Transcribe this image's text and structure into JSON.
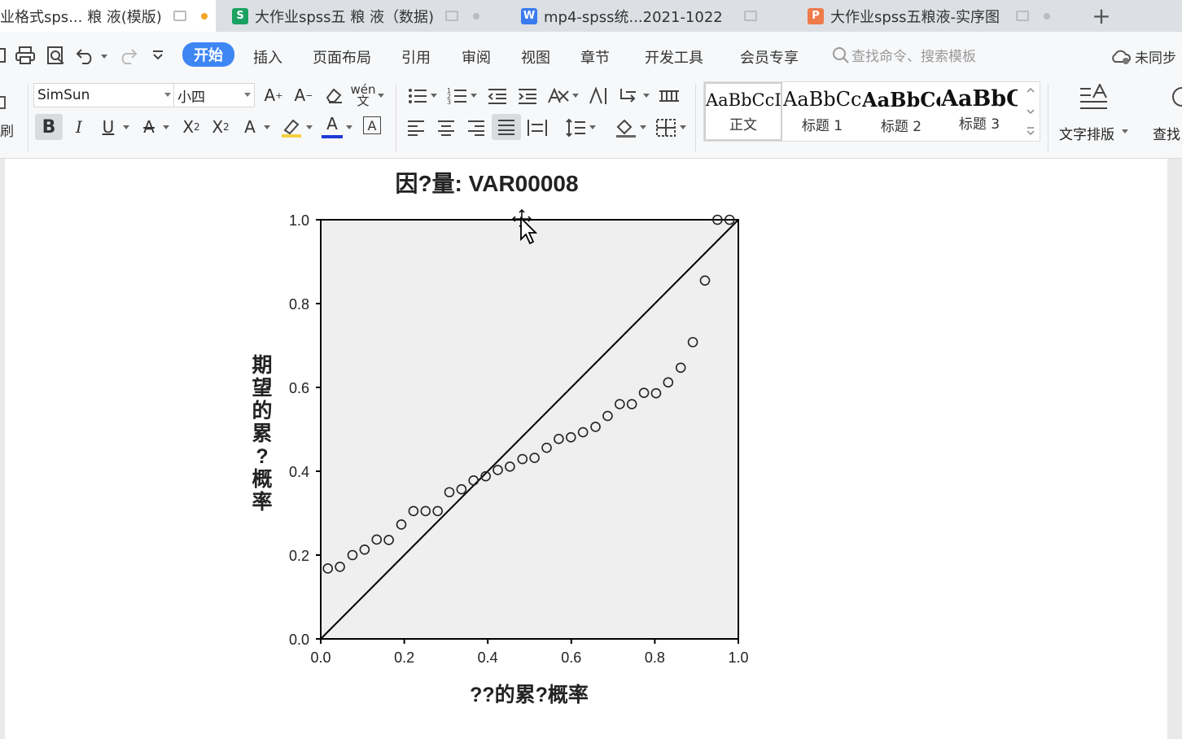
{
  "tabs": [
    {
      "title": "业格式sps... 粮 液(模版)",
      "active": true,
      "app": "writer"
    },
    {
      "title": "大作业spss五 粮 液（数据)",
      "app_icon": "S",
      "app_color": "#1aa261"
    },
    {
      "title": "mp4-spss统...2021-1022",
      "app_icon": "W",
      "app_color": "#3a7bf0"
    },
    {
      "title": "大作业spss五粮液-实序图",
      "app_icon": "P",
      "app_color": "#ef7a4a"
    }
  ],
  "new_tab_label": "+",
  "menu": {
    "items": [
      "开始",
      "插入",
      "页面布局",
      "引用",
      "审阅",
      "视图",
      "章节",
      "开发工具",
      "会员专享"
    ],
    "active": "开始",
    "search_placeholder": "查找命令、搜索模板",
    "sync_label": "未同步"
  },
  "ribbon": {
    "left_cut_label": "刷",
    "font_name": "SimSun",
    "font_size": "小四",
    "pinyin_label": "wén",
    "styles": [
      {
        "sample": "AaBbCcI",
        "name": "正文"
      },
      {
        "sample": "AaBbCc",
        "name": "标题 1"
      },
      {
        "sample": "AaBbCc",
        "name": "标题 2"
      },
      {
        "sample": "AaBbC",
        "name": "标题 3"
      }
    ],
    "text_layout_label": "文字排版",
    "find_label": "查找"
  },
  "chart_data": {
    "type": "scatter",
    "title": "因?量: VAR00008",
    "xlabel": "??的累?概率",
    "ylabel": "期望的累?概率",
    "xlim": [
      0,
      1
    ],
    "ylim": [
      0,
      1
    ],
    "xticks": [
      "0.0",
      "0.2",
      "0.4",
      "0.6",
      "0.8",
      "1.0"
    ],
    "yticks": [
      "0.0",
      "0.2",
      "0.4",
      "0.6",
      "0.8",
      "1.0"
    ],
    "reference_line": "diagonal",
    "background": "#efefef",
    "points": [
      [
        0.017,
        0.168
      ],
      [
        0.046,
        0.172
      ],
      [
        0.076,
        0.2
      ],
      [
        0.105,
        0.213
      ],
      [
        0.134,
        0.237
      ],
      [
        0.163,
        0.236
      ],
      [
        0.193,
        0.273
      ],
      [
        0.222,
        0.305
      ],
      [
        0.251,
        0.305
      ],
      [
        0.28,
        0.305
      ],
      [
        0.308,
        0.35
      ],
      [
        0.337,
        0.357
      ],
      [
        0.366,
        0.378
      ],
      [
        0.395,
        0.388
      ],
      [
        0.424,
        0.403
      ],
      [
        0.453,
        0.411
      ],
      [
        0.483,
        0.429
      ],
      [
        0.512,
        0.432
      ],
      [
        0.541,
        0.456
      ],
      [
        0.57,
        0.477
      ],
      [
        0.599,
        0.481
      ],
      [
        0.628,
        0.493
      ],
      [
        0.658,
        0.506
      ],
      [
        0.687,
        0.532
      ],
      [
        0.716,
        0.56
      ],
      [
        0.745,
        0.56
      ],
      [
        0.774,
        0.587
      ],
      [
        0.803,
        0.586
      ],
      [
        0.832,
        0.612
      ],
      [
        0.862,
        0.647
      ],
      [
        0.891,
        0.708
      ],
      [
        0.92,
        0.855
      ],
      [
        0.95,
        1.0
      ],
      [
        0.979,
        1.0
      ]
    ]
  }
}
